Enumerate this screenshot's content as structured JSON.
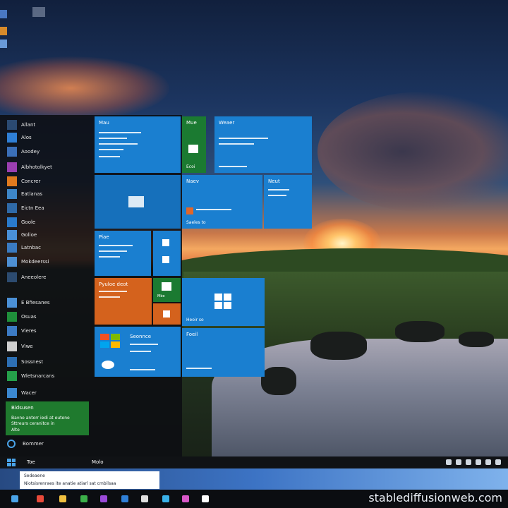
{
  "start_menu": {
    "apps": [
      {
        "label": "Allant",
        "color": "#2b4a72"
      },
      {
        "label": "Alos",
        "color": "#2f7fd6"
      },
      {
        "label": "Aoodey",
        "color": "#3b6fb8"
      },
      {
        "label": "Albhotolkyet",
        "color": "#9b3fb0"
      },
      {
        "label": "Concrer",
        "color": "#e07a1e"
      },
      {
        "label": "Eatlanas",
        "color": "#3d86c8"
      },
      {
        "label": "Eictn Eea",
        "color": "#2f6aa8"
      },
      {
        "label": "Goole",
        "color": "#2a7acb"
      },
      {
        "label": "Golioe",
        "color": "#4a90d8"
      },
      {
        "label": "Latnbac",
        "color": "#3a7bc2"
      },
      {
        "label": "Mokdeerssi",
        "color": "#4d8fd2"
      },
      {
        "label": "Aneeolere",
        "color": "#2c4b70"
      },
      {
        "label": "E Bfiesanes",
        "color": "#4b90d6"
      },
      {
        "label": "Osuas",
        "color": "#1f8f3b"
      },
      {
        "label": "Vieres",
        "color": "#3c7bc4"
      },
      {
        "label": "Viwe",
        "color": "#cfcfcf"
      },
      {
        "label": "Sossnest",
        "color": "#2d6fb3"
      },
      {
        "label": "Wletsnarcans",
        "color": "#25a04a"
      },
      {
        "label": "Wacer",
        "color": "#3b88d0"
      }
    ],
    "green_panel": {
      "title": "Bidsusen",
      "line1": "Bavne antorr iedi at eutene",
      "line2": "Sttreurs ceranitce in",
      "line3": "Alte"
    },
    "power_label": "Bommer"
  },
  "tiles": {
    "mail": {
      "label": "Mau"
    },
    "store": {
      "label": "Mue",
      "foot": "Ecoi"
    },
    "calendar": {
      "label": "Weaer"
    },
    "news": {
      "label": "Nuer"
    },
    "photos": {
      "label": "Naev",
      "foot": "Saeles to"
    },
    "weather": {
      "label": "Neut"
    },
    "people": {
      "label": "Piae"
    },
    "dual1": {
      "label": "Naaaotsane"
    },
    "office": {
      "label": "Pyuloe deot"
    },
    "xbox": {
      "label": "Xbtio",
      "foot": "Mbe"
    },
    "money": {
      "label": "Fuse"
    },
    "windows": {
      "label": "Noter",
      "foot": "Heoir so"
    },
    "groove": {
      "label": "Seonnce"
    },
    "sports": {
      "label": "Foeil",
      "foot": "Seoro at"
    }
  },
  "taskbar_top": {
    "search_label": "Toe",
    "back_label": "Molo"
  },
  "notification": {
    "line1": "Sedeaene",
    "line2": "Niotsisrenraes ite anatie atiarl sat cmbilsaa"
  },
  "watermark": "stablediffusionweb.com",
  "colors": {
    "tile_blue": "#1a7fd0",
    "tile_green": "#1b7a31",
    "tile_orange": "#d4621d",
    "start_bg": "#0c0e12"
  }
}
